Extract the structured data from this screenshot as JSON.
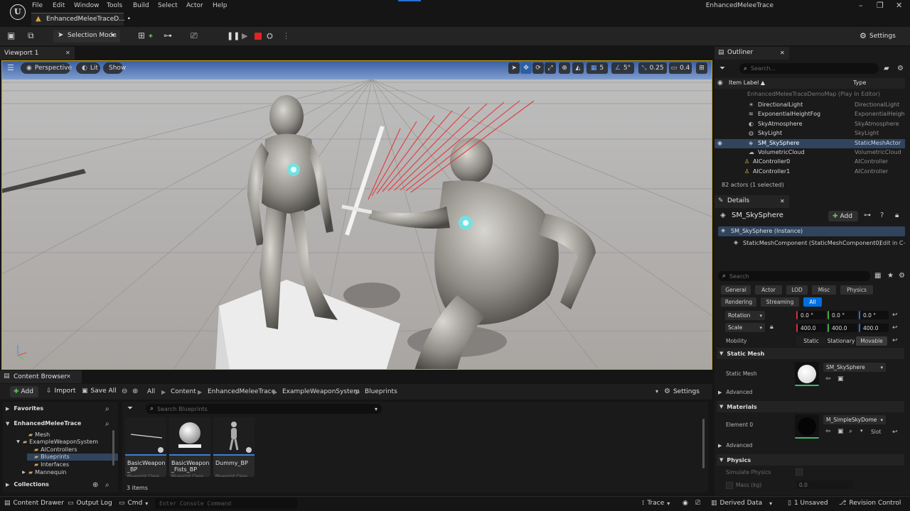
{
  "menu": [
    "File",
    "Edit",
    "Window",
    "Tools",
    "Build",
    "Select",
    "Actor",
    "Help"
  ],
  "document_tab": "EnhancedMeleeTraceD... •",
  "project_title": "EnhancedMeleeTrace",
  "toolbar": {
    "selection_mode": "Selection Mode",
    "settings": "Settings"
  },
  "viewport": {
    "tab": "Viewport 1",
    "perspective": "Perspective",
    "lit": "Lit",
    "show": "Show",
    "grid_snap": "5",
    "angle_snap": "5°",
    "scale_snap": "0.25",
    "camera_speed": "0.4"
  },
  "outliner": {
    "tab": "Outliner",
    "search_placeholder": "Search...",
    "col_label": "Item Label ▲",
    "col_type": "Type",
    "map_row": "EnhancedMeleeTraceDemoMap (Play In Editor)",
    "rows": [
      {
        "label": "DirectionalLight",
        "type": "DirectionalLight",
        "icon": "☀"
      },
      {
        "label": "ExponentialHeightFog",
        "type": "ExponentialHeigh",
        "icon": "≋"
      },
      {
        "label": "SkyAtmosphere",
        "type": "SkyAtmosphere",
        "icon": "◐"
      },
      {
        "label": "SkyLight",
        "type": "SkyLight",
        "icon": "◍"
      },
      {
        "label": "SM_SkySphere",
        "type": "StaticMeshActor",
        "icon": "◈"
      },
      {
        "label": "VolumetricCloud",
        "type": "VolumetricCloud",
        "icon": "☁"
      },
      {
        "label": "AIController0",
        "type": "AIController",
        "icon": "♙"
      },
      {
        "label": "AIController1",
        "type": "AIController",
        "icon": "♙"
      }
    ],
    "count": "82 actors (1 selected)"
  },
  "details": {
    "tab": "Details",
    "actor_name": "SM_SkySphere",
    "add": "Add",
    "instance": "SM_SkySphere (Instance)",
    "component": "StaticMeshComponent (StaticMeshComponent0)",
    "edit_cpp": "Edit in C++",
    "search_placeholder": "Search",
    "filters_row1": [
      "General",
      "Actor",
      "LOD",
      "Misc",
      "Physics"
    ],
    "filters_row2": [
      "Rendering",
      "Streaming",
      "All"
    ],
    "rotation_label": "Rotation",
    "rotation": [
      "0.0 °",
      "0.0 °",
      "0.0 °"
    ],
    "scale_label": "Scale",
    "scale": [
      "400.0",
      "400.0",
      "400.0"
    ],
    "mobility_label": "Mobility",
    "mobility_options": [
      "Static",
      "Stationary",
      "Movable"
    ],
    "section_static_mesh": "Static Mesh",
    "static_mesh_label": "Static Mesh",
    "static_mesh_value": "SM_SkySphere",
    "advanced": "Advanced",
    "section_materials": "Materials",
    "element0_label": "Element 0",
    "element0_value": "M_SimpleSkyDome",
    "slot": "Slot",
    "section_physics": "Physics",
    "simulate_physics": "Simulate Physics",
    "mass": "Mass (kg)",
    "mass_value": "0.0"
  },
  "content_browser": {
    "tab": "Content Browser",
    "add": "Add",
    "import": "Import",
    "save_all": "Save All",
    "breadcrumb": [
      "All",
      "Content",
      "EnhancedMeleeTrace",
      "ExampleWeaponSystem",
      "Blueprints"
    ],
    "settings": "Settings",
    "favorites": "Favorites",
    "root": "EnhancedMeleeTrace",
    "tree": [
      "Mesh",
      "ExampleWeaponSystem",
      "AIControllers",
      "Blueprints",
      "Interfaces",
      "Mannequin"
    ],
    "collections": "Collections",
    "search_placeholder": "Search Blueprints",
    "assets": [
      {
        "name": "BasicWeapon_BP",
        "class": "Blueprint Class"
      },
      {
        "name": "BasicWeapon_Fists_BP",
        "class": "Blueprint Class"
      },
      {
        "name": "Dummy_BP",
        "class": "Blueprint Class"
      }
    ],
    "item_count": "3 items"
  },
  "statusbar": {
    "content_drawer": "Content Drawer",
    "output_log": "Output Log",
    "cmd": "Cmd",
    "console_placeholder": "Enter Console Command",
    "trace": "Trace",
    "derived_data": "Derived Data",
    "unsaved": "1 Unsaved",
    "revision_control": "Revision Control"
  }
}
